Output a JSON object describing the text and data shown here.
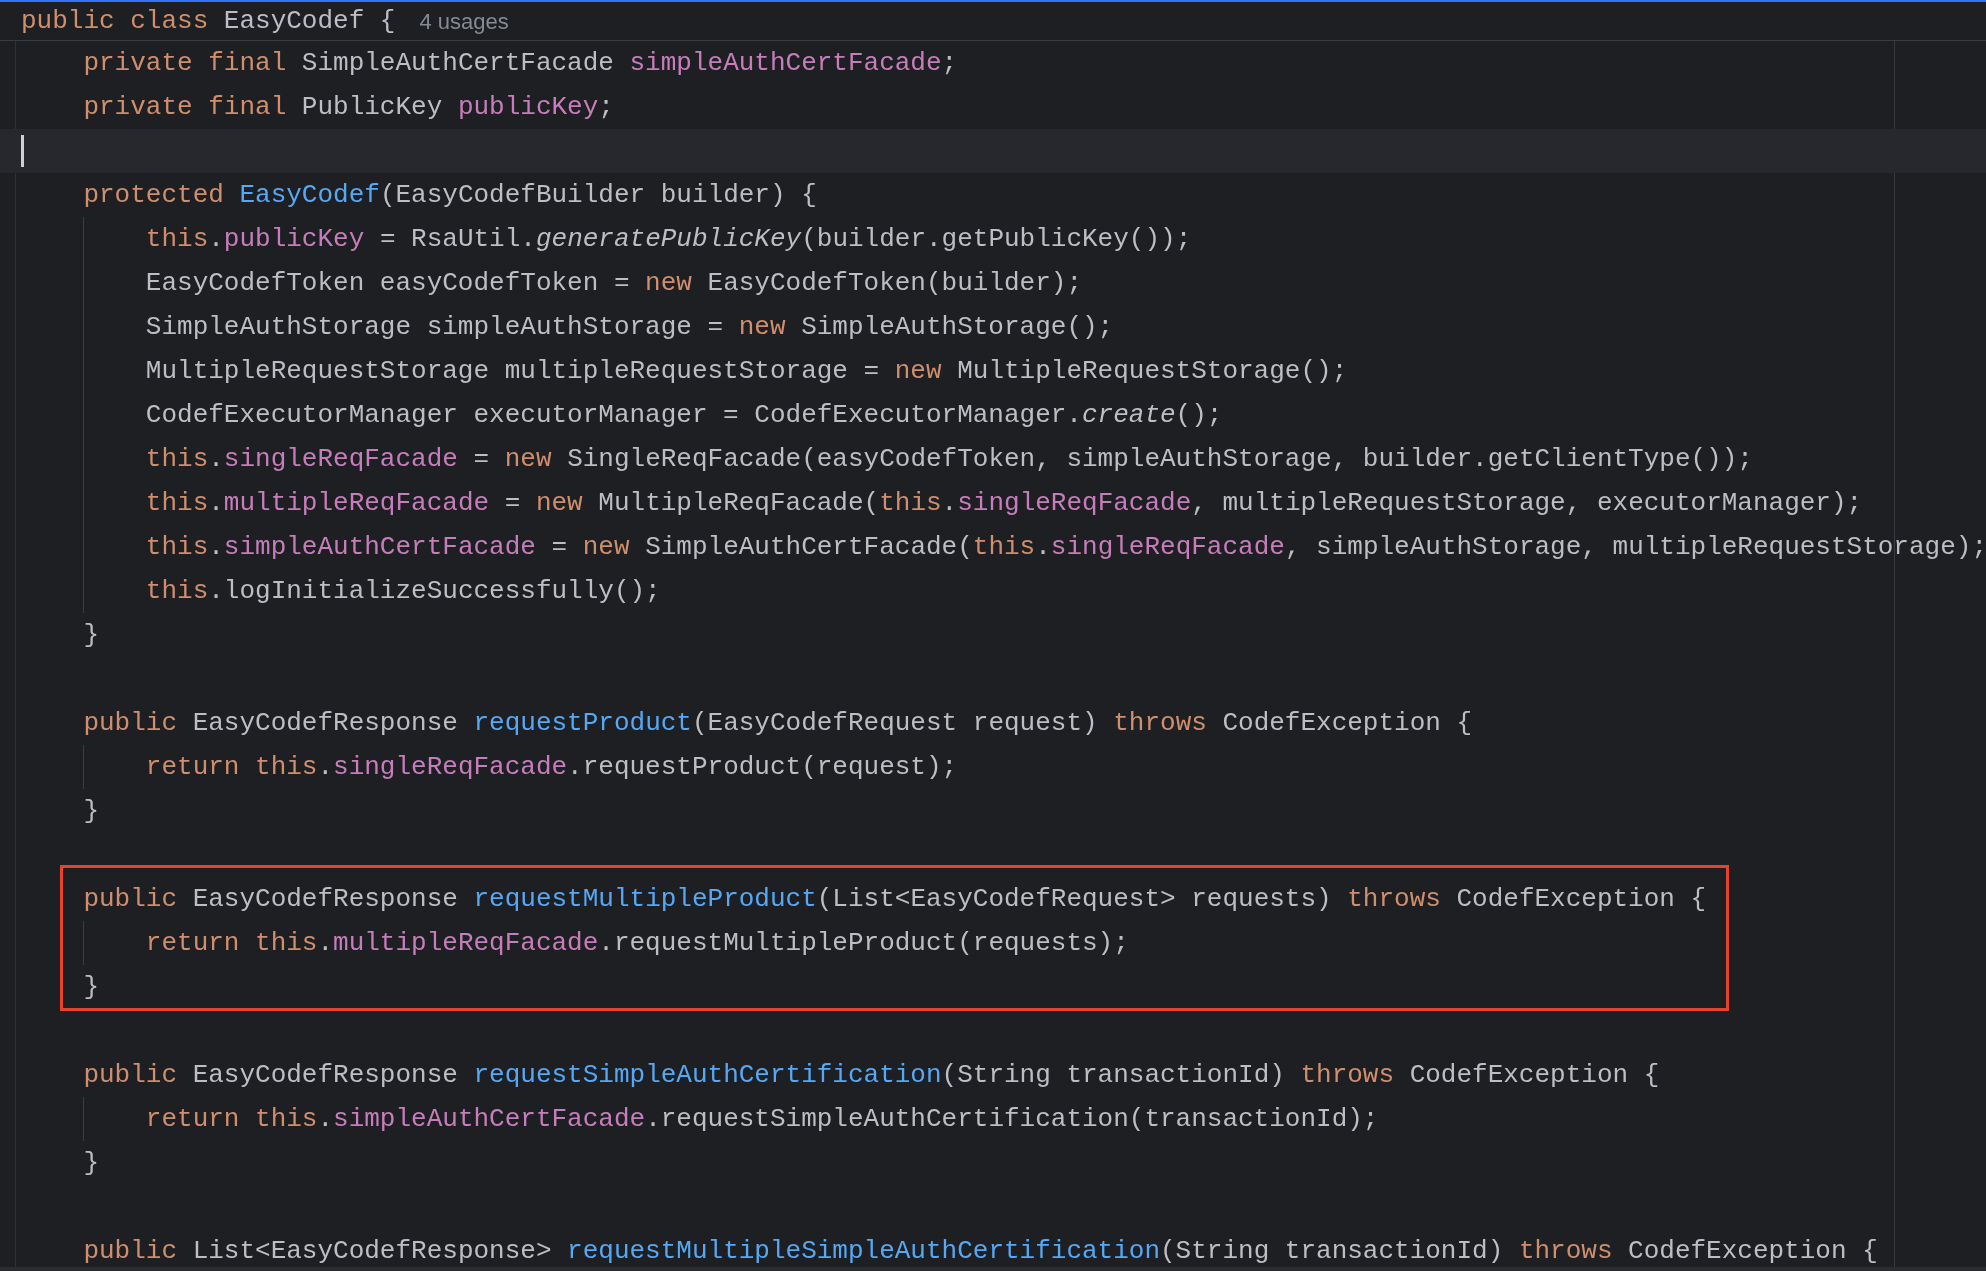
{
  "header": {
    "tokens": [
      {
        "kind": "kw",
        "text": "public class "
      },
      {
        "kind": "plain",
        "text": "EasyCodef {"
      }
    ],
    "hint": "4 usages"
  },
  "lines": [
    {
      "kind": "line",
      "tokens": [
        {
          "kind": "kw",
          "text": "    private final "
        },
        {
          "kind": "plain",
          "text": "SimpleAuthCertFacade "
        },
        {
          "kind": "field",
          "text": "simpleAuthCertFacade"
        },
        {
          "kind": "plain",
          "text": ";"
        }
      ]
    },
    {
      "kind": "line",
      "tokens": [
        {
          "kind": "kw",
          "text": "    private final "
        },
        {
          "kind": "plain",
          "text": "PublicKey "
        },
        {
          "kind": "field",
          "text": "publicKey"
        },
        {
          "kind": "plain",
          "text": ";"
        }
      ]
    },
    {
      "kind": "caret_line"
    },
    {
      "kind": "line",
      "tokens": [
        {
          "kind": "kw",
          "text": "    protected "
        },
        {
          "kind": "decl",
          "text": "EasyCodef"
        },
        {
          "kind": "plain",
          "text": "(EasyCodefBuilder builder) {"
        }
      ]
    },
    {
      "kind": "line",
      "tokens": [
        {
          "kind": "kw",
          "text": "        this"
        },
        {
          "kind": "plain",
          "text": "."
        },
        {
          "kind": "field",
          "text": "publicKey"
        },
        {
          "kind": "plain",
          "text": " = RsaUtil."
        },
        {
          "kind": "static",
          "text": "generatePublicKey"
        },
        {
          "kind": "plain",
          "text": "(builder.getPublicKey());"
        }
      ]
    },
    {
      "kind": "line",
      "tokens": [
        {
          "kind": "plain",
          "text": "        EasyCodefToken easyCodefToken = "
        },
        {
          "kind": "kw",
          "text": "new "
        },
        {
          "kind": "plain",
          "text": "EasyCodefToken(builder);"
        }
      ]
    },
    {
      "kind": "line",
      "tokens": [
        {
          "kind": "plain",
          "text": "        SimpleAuthStorage simpleAuthStorage = "
        },
        {
          "kind": "kw",
          "text": "new "
        },
        {
          "kind": "plain",
          "text": "SimpleAuthStorage();"
        }
      ]
    },
    {
      "kind": "line",
      "tokens": [
        {
          "kind": "plain",
          "text": "        MultipleRequestStorage multipleRequestStorage = "
        },
        {
          "kind": "kw",
          "text": "new "
        },
        {
          "kind": "plain",
          "text": "MultipleRequestStorage();"
        }
      ]
    },
    {
      "kind": "line",
      "tokens": [
        {
          "kind": "plain",
          "text": "        CodefExecutorManager executorManager = CodefExecutorManager."
        },
        {
          "kind": "static",
          "text": "create"
        },
        {
          "kind": "plain",
          "text": "();"
        }
      ]
    },
    {
      "kind": "line",
      "tokens": [
        {
          "kind": "kw",
          "text": "        this"
        },
        {
          "kind": "plain",
          "text": "."
        },
        {
          "kind": "field",
          "text": "singleReqFacade"
        },
        {
          "kind": "plain",
          "text": " = "
        },
        {
          "kind": "kw",
          "text": "new "
        },
        {
          "kind": "plain",
          "text": "SingleReqFacade(easyCodefToken, simpleAuthStorage, builder.getClientType());"
        }
      ]
    },
    {
      "kind": "line",
      "tokens": [
        {
          "kind": "kw",
          "text": "        this"
        },
        {
          "kind": "plain",
          "text": "."
        },
        {
          "kind": "field",
          "text": "multipleReqFacade"
        },
        {
          "kind": "plain",
          "text": " = "
        },
        {
          "kind": "kw",
          "text": "new "
        },
        {
          "kind": "plain",
          "text": "MultipleReqFacade("
        },
        {
          "kind": "kw",
          "text": "this"
        },
        {
          "kind": "plain",
          "text": "."
        },
        {
          "kind": "field",
          "text": "singleReqFacade"
        },
        {
          "kind": "plain",
          "text": ", multipleRequestStorage, executorManager);"
        }
      ]
    },
    {
      "kind": "line",
      "tokens": [
        {
          "kind": "kw",
          "text": "        this"
        },
        {
          "kind": "plain",
          "text": "."
        },
        {
          "kind": "field",
          "text": "simpleAuthCertFacade"
        },
        {
          "kind": "plain",
          "text": " = "
        },
        {
          "kind": "kw",
          "text": "new "
        },
        {
          "kind": "plain",
          "text": "SimpleAuthCertFacade("
        },
        {
          "kind": "kw",
          "text": "this"
        },
        {
          "kind": "plain",
          "text": "."
        },
        {
          "kind": "field",
          "text": "singleReqFacade"
        },
        {
          "kind": "plain",
          "text": ", simpleAuthStorage, multipleRequestStorage);"
        }
      ]
    },
    {
      "kind": "line",
      "tokens": [
        {
          "kind": "kw",
          "text": "        this"
        },
        {
          "kind": "plain",
          "text": ".logInitializeSuccessfully();"
        }
      ]
    },
    {
      "kind": "line",
      "tokens": [
        {
          "kind": "plain",
          "text": "    }"
        }
      ]
    },
    {
      "kind": "line"
    },
    {
      "kind": "line",
      "tokens": [
        {
          "kind": "kw",
          "text": "    public "
        },
        {
          "kind": "plain",
          "text": "EasyCodefResponse "
        },
        {
          "kind": "decl",
          "text": "requestProduct"
        },
        {
          "kind": "plain",
          "text": "(EasyCodefRequest request) "
        },
        {
          "kind": "kw",
          "text": "throws "
        },
        {
          "kind": "plain",
          "text": "CodefException {"
        }
      ]
    },
    {
      "kind": "line",
      "tokens": [
        {
          "kind": "kw",
          "text": "        return this"
        },
        {
          "kind": "plain",
          "text": "."
        },
        {
          "kind": "field",
          "text": "singleReqFacade"
        },
        {
          "kind": "plain",
          "text": ".requestProduct(request);"
        }
      ]
    },
    {
      "kind": "line",
      "tokens": [
        {
          "kind": "plain",
          "text": "    }"
        }
      ]
    },
    {
      "kind": "line"
    },
    {
      "kind": "highlight_box",
      "lines": [
        {
          "kind": "line",
          "tokens": [
            {
              "kind": "kw",
              "text": "    public "
            },
            {
              "kind": "plain",
              "text": "EasyCodefResponse "
            },
            {
              "kind": "decl",
              "text": "requestMultipleProduct"
            },
            {
              "kind": "plain",
              "text": "(List<EasyCodefRequest> requests) "
            },
            {
              "kind": "kw",
              "text": "throws "
            },
            {
              "kind": "plain",
              "text": "CodefException {"
            }
          ]
        },
        {
          "kind": "line",
          "tokens": [
            {
              "kind": "kw",
              "text": "        return this"
            },
            {
              "kind": "plain",
              "text": "."
            },
            {
              "kind": "field",
              "text": "multipleReqFacade"
            },
            {
              "kind": "plain",
              "text": ".requestMultipleProduct(requests);"
            }
          ]
        },
        {
          "kind": "line",
          "tokens": [
            {
              "kind": "plain",
              "text": "    }"
            }
          ]
        }
      ]
    },
    {
      "kind": "line"
    },
    {
      "kind": "line",
      "tokens": [
        {
          "kind": "kw",
          "text": "    public "
        },
        {
          "kind": "plain",
          "text": "EasyCodefResponse "
        },
        {
          "kind": "decl",
          "text": "requestSimpleAuthCertification"
        },
        {
          "kind": "plain",
          "text": "(String transactionId) "
        },
        {
          "kind": "kw",
          "text": "throws "
        },
        {
          "kind": "plain",
          "text": "CodefException {"
        }
      ]
    },
    {
      "kind": "line",
      "tokens": [
        {
          "kind": "kw",
          "text": "        return this"
        },
        {
          "kind": "plain",
          "text": "."
        },
        {
          "kind": "field",
          "text": "simpleAuthCertFacade"
        },
        {
          "kind": "plain",
          "text": ".requestSimpleAuthCertification(transactionId);"
        }
      ]
    },
    {
      "kind": "line",
      "tokens": [
        {
          "kind": "plain",
          "text": "    }"
        }
      ]
    },
    {
      "kind": "line"
    },
    {
      "kind": "line",
      "tokens": [
        {
          "kind": "kw",
          "text": "    public "
        },
        {
          "kind": "plain",
          "text": "List<EasyCodefResponse> "
        },
        {
          "kind": "decl",
          "text": "requestMultipleSimpleAuthCertification"
        },
        {
          "kind": "plain",
          "text": "(String transactionId) "
        },
        {
          "kind": "kw",
          "text": "throws "
        },
        {
          "kind": "plain",
          "text": "CodefException {"
        }
      ]
    }
  ]
}
